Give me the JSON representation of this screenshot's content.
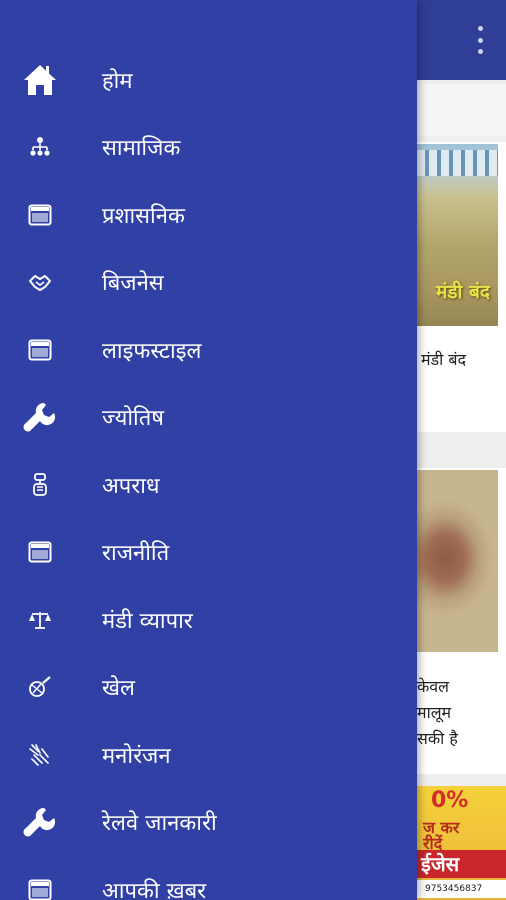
{
  "background": {
    "cards": [
      {
        "thumbnail_text": "मंडी बंद",
        "title": "मंडी बंद"
      },
      {
        "title_lines": [
          "केवल",
          "मालूम",
          "सकी है"
        ]
      }
    ],
    "ad": {
      "line_pct": "0%",
      "line1": "ज कर",
      "line2": "रीदें",
      "brand": "ईजेस",
      "phone": "9753456837"
    }
  },
  "drawer": {
    "items": [
      {
        "label": "होम",
        "icon": "home-icon"
      },
      {
        "label": "सामाजिक",
        "icon": "people-hierarchy-icon"
      },
      {
        "label": "प्रशासनिक",
        "icon": "window-icon"
      },
      {
        "label": "बिजनेस",
        "icon": "handshake-icon"
      },
      {
        "label": "लाइफस्टाइल",
        "icon": "window-icon"
      },
      {
        "label": "ज्योतिष",
        "icon": "wrench-icon"
      },
      {
        "label": "अपराध",
        "icon": "handcuff-icon"
      },
      {
        "label": "राजनीति",
        "icon": "window-icon"
      },
      {
        "label": "मंडी व्यापार",
        "icon": "scale-icon"
      },
      {
        "label": "खेल",
        "icon": "sport-icon"
      },
      {
        "label": "मनोरंजन",
        "icon": "entertainment-icon"
      },
      {
        "label": "रेलवे जानकारी",
        "icon": "wrench-icon"
      },
      {
        "label": "आपकी ख़बर",
        "icon": "window-icon"
      }
    ]
  },
  "colors": {
    "drawer_bg": "#3040a4",
    "app_bar": "#2f3f98",
    "text": "#ffffff"
  }
}
